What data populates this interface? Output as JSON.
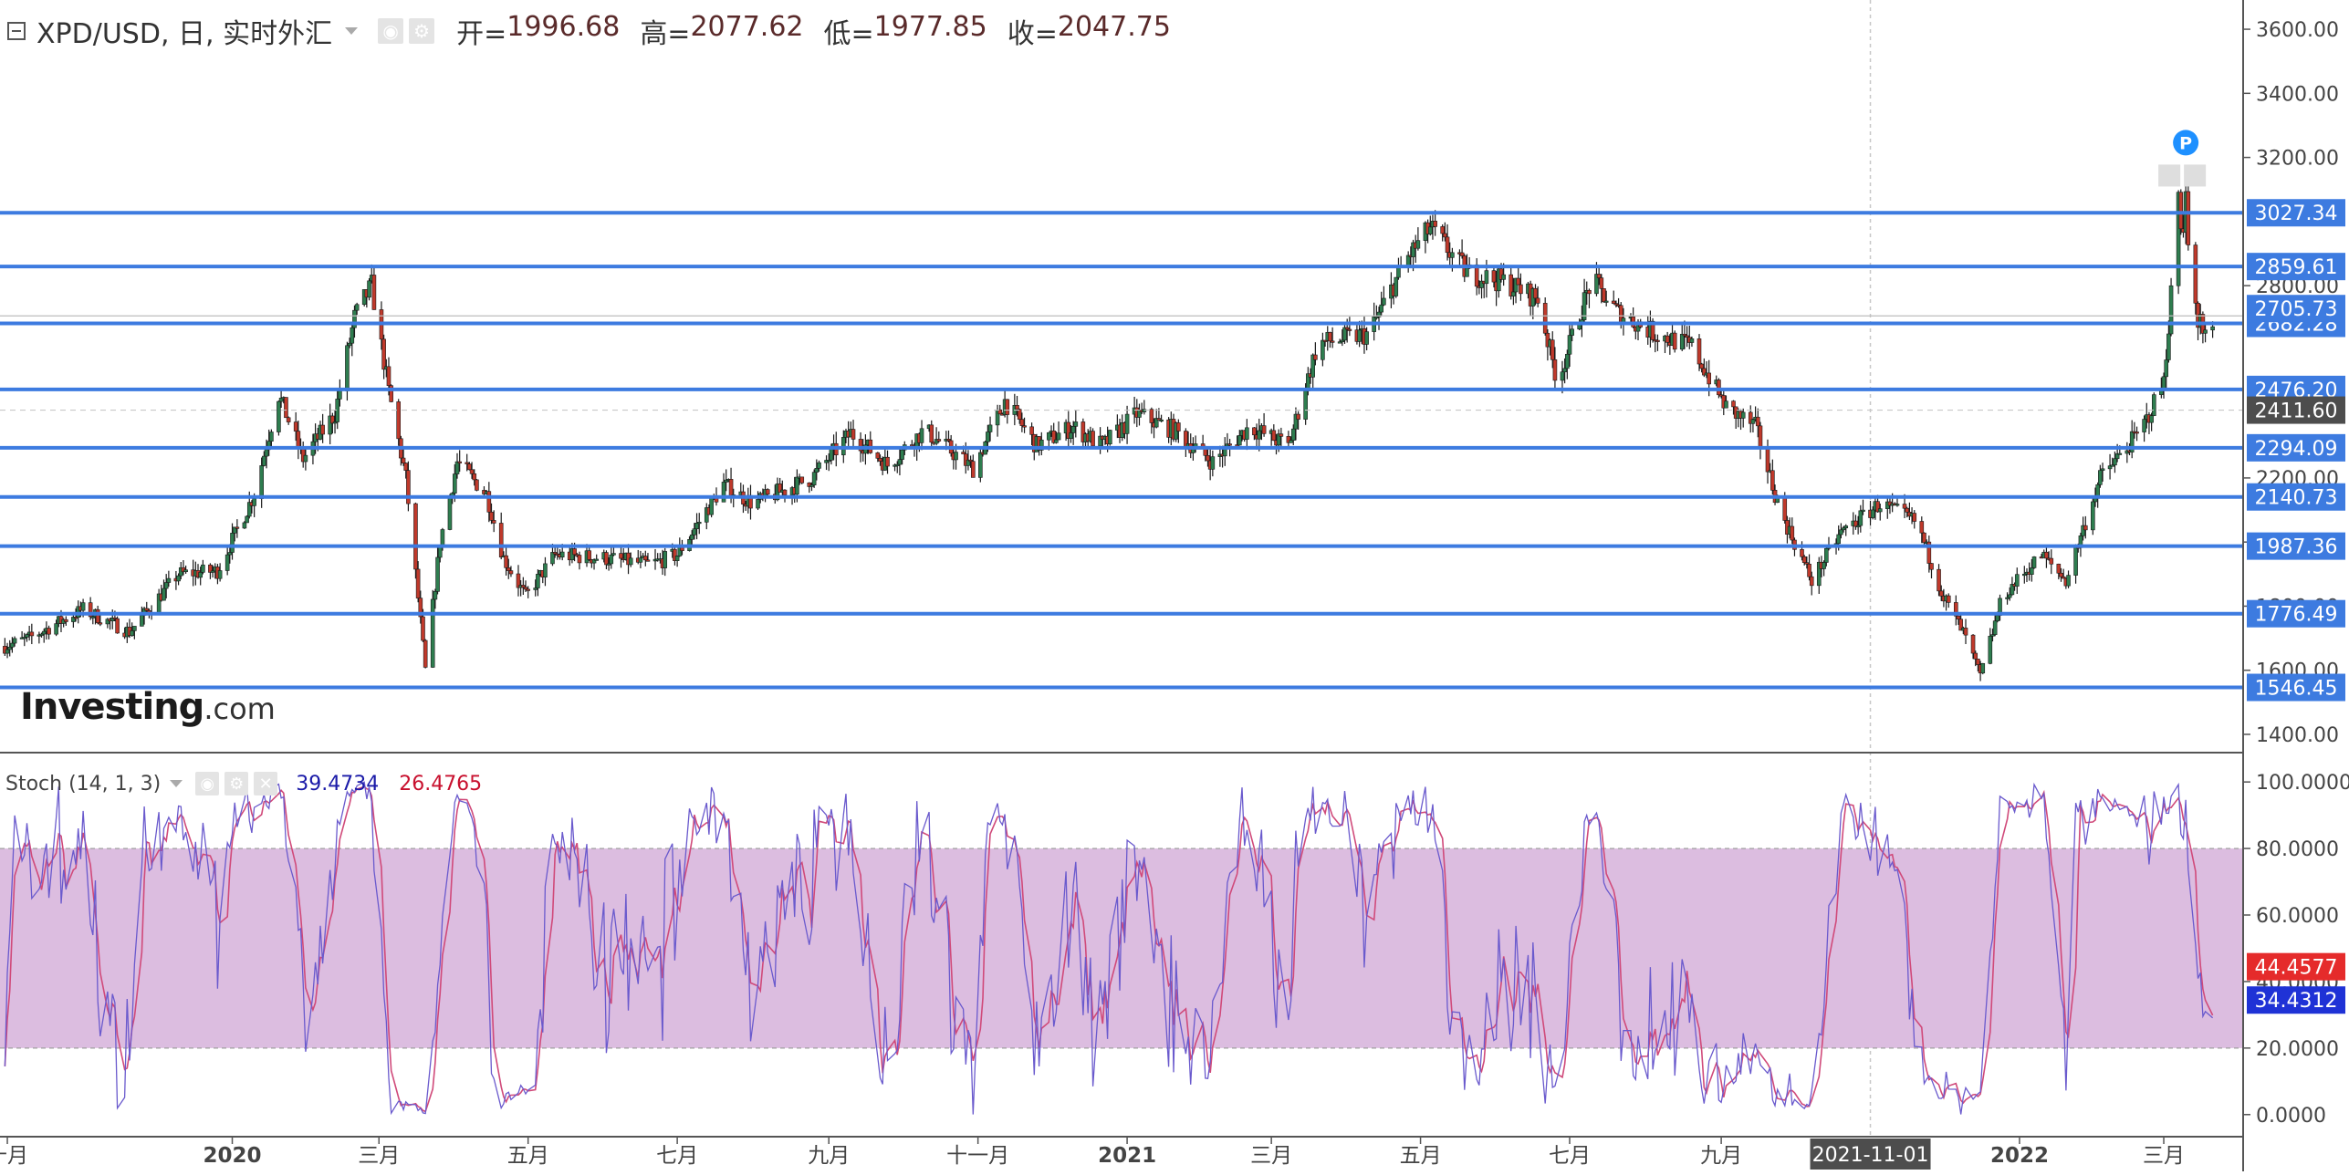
{
  "header": {
    "symbol_title": "XPD/USD, 日, 实时外汇",
    "ohlc": [
      {
        "label": "开=",
        "value": "1996.68"
      },
      {
        "label": "高=",
        "value": "2077.62"
      },
      {
        "label": "低=",
        "value": "1977.85"
      },
      {
        "label": "收=",
        "value": "2047.75"
      }
    ]
  },
  "logo": {
    "brand": "Investing",
    "suffix": ".com"
  },
  "stoch_panel": {
    "label": "Stoch (14, 1, 3)",
    "k_value": "39.4734",
    "d_value": "26.4765"
  },
  "colors": {
    "up": "#2e7d4f",
    "down": "#c0392b",
    "hline": "#3d7be0",
    "stoch_k": "#6a5acd",
    "stoch_d": "#d04a7a",
    "stoch_band": "#dcbde0",
    "badge_blue": "#3d7be0",
    "badge_red": "#e52b2b",
    "badge_dark": "#4d4d4d",
    "badge_navy": "#1f32d6"
  },
  "chart_data": [
    {
      "type": "candlestick",
      "title": "XPD/USD, 日, 实时外汇",
      "x_ticks": [
        {
          "date": "2019-10-01",
          "label": "十月",
          "bold": false
        },
        {
          "date": "2020-01-01",
          "label": "2020",
          "bold": true
        },
        {
          "date": "2020-03-01",
          "label": "三月",
          "bold": false
        },
        {
          "date": "2020-05-01",
          "label": "五月",
          "bold": false
        },
        {
          "date": "2020-07-01",
          "label": "七月",
          "bold": false
        },
        {
          "date": "2020-09-01",
          "label": "九月",
          "bold": false
        },
        {
          "date": "2020-11-01",
          "label": "十一月",
          "bold": false
        },
        {
          "date": "2021-01-01",
          "label": "2021",
          "bold": true
        },
        {
          "date": "2021-03-01",
          "label": "三月",
          "bold": false
        },
        {
          "date": "2021-05-01",
          "label": "五月",
          "bold": false
        },
        {
          "date": "2021-07-01",
          "label": "七月",
          "bold": false
        },
        {
          "date": "2021-09-01",
          "label": "九月",
          "bold": false
        },
        {
          "date": "2022-01-01",
          "label": "2022",
          "bold": true
        },
        {
          "date": "2022-03-01",
          "label": "三月",
          "bold": false
        }
      ],
      "x_range": [
        "2019-09-28",
        "2022-03-26"
      ],
      "crosshair_date": "2021-11-01",
      "crosshair_label": "2021-11-01",
      "y_ticks": [
        1400,
        1600,
        1800,
        2000,
        2200,
        2800,
        3200,
        3400,
        3600
      ],
      "y_tick_labels": [
        "1400.00",
        "1600.00",
        "1800.00",
        "2000.00",
        "2200.00",
        "2800.00",
        "3200.00",
        "3400.00",
        "3600.00"
      ],
      "ylim": [
        1380,
        3640
      ],
      "horizontal_levels": [
        3027.34,
        2859.61,
        2682.28,
        2476.2,
        2294.09,
        2140.73,
        1987.36,
        1776.49,
        1546.45
      ],
      "horizontal_level_labels": [
        "3027.34",
        "2859.61",
        "2682.28",
        "2476.20",
        "2294.09",
        "2140.73",
        "1987.36",
        "1776.49",
        "1546.45"
      ],
      "price_badges": [
        {
          "value": 2705.73,
          "label": "2705.73",
          "kind": "current"
        },
        {
          "value": 2411.6,
          "label": "2411.60",
          "kind": "marker"
        }
      ],
      "marker_label": "P",
      "anchors": [
        [
          "2019-09-28",
          1670
        ],
        [
          "2019-10-10",
          1700
        ],
        [
          "2019-11-01",
          1790
        ],
        [
          "2019-11-20",
          1720
        ],
        [
          "2019-12-10",
          1900
        ],
        [
          "2019-12-26",
          1910
        ],
        [
          "2020-01-10",
          2150
        ],
        [
          "2020-01-20",
          2460
        ],
        [
          "2020-01-30",
          2260
        ],
        [
          "2020-02-12",
          2400
        ],
        [
          "2020-02-20",
          2700
        ],
        [
          "2020-02-27",
          2800
        ],
        [
          "2020-03-05",
          2470
        ],
        [
          "2020-03-12",
          2200
        ],
        [
          "2020-03-20",
          1600
        ],
        [
          "2020-03-26",
          2000
        ],
        [
          "2020-04-02",
          2250
        ],
        [
          "2020-04-14",
          2150
        ],
        [
          "2020-04-21",
          1950
        ],
        [
          "2020-04-30",
          1830
        ],
        [
          "2020-05-12",
          1960
        ],
        [
          "2020-06-01",
          1950
        ],
        [
          "2020-06-20",
          1930
        ],
        [
          "2020-07-01",
          1960
        ],
        [
          "2020-07-20",
          2180
        ],
        [
          "2020-08-01",
          2120
        ],
        [
          "2020-08-25",
          2200
        ],
        [
          "2020-09-10",
          2340
        ],
        [
          "2020-09-25",
          2240
        ],
        [
          "2020-10-10",
          2350
        ],
        [
          "2020-10-30",
          2230
        ],
        [
          "2020-11-12",
          2440
        ],
        [
          "2020-11-25",
          2300
        ],
        [
          "2020-12-10",
          2360
        ],
        [
          "2020-12-22",
          2300
        ],
        [
          "2021-01-05",
          2400
        ],
        [
          "2021-01-20",
          2350
        ],
        [
          "2021-02-05",
          2250
        ],
        [
          "2021-02-20",
          2360
        ],
        [
          "2021-03-08",
          2300
        ],
        [
          "2021-03-20",
          2620
        ],
        [
          "2021-04-10",
          2650
        ],
        [
          "2021-04-25",
          2880
        ],
        [
          "2021-05-05",
          2980
        ],
        [
          "2021-05-20",
          2840
        ],
        [
          "2021-06-05",
          2810
        ],
        [
          "2021-06-18",
          2760
        ],
        [
          "2021-06-26",
          2500
        ],
        [
          "2021-07-10",
          2820
        ],
        [
          "2021-07-20",
          2720
        ],
        [
          "2021-08-05",
          2650
        ],
        [
          "2021-08-20",
          2610
        ],
        [
          "2021-09-03",
          2420
        ],
        [
          "2021-09-15",
          2360
        ],
        [
          "2021-09-25",
          2100
        ],
        [
          "2021-10-08",
          1880
        ],
        [
          "2021-10-20",
          2030
        ],
        [
          "2021-11-05",
          2120
        ],
        [
          "2021-11-20",
          2060
        ],
        [
          "2021-12-01",
          1830
        ],
        [
          "2021-12-10",
          1700
        ],
        [
          "2021-12-16",
          1580
        ],
        [
          "2021-12-25",
          1830
        ],
        [
          "2022-01-10",
          1960
        ],
        [
          "2022-01-20",
          1880
        ],
        [
          "2022-02-03",
          2200
        ],
        [
          "2022-02-20",
          2350
        ],
        [
          "2022-03-01",
          2500
        ],
        [
          "2022-03-07",
          3050
        ],
        [
          "2022-03-09",
          3000
        ],
        [
          "2022-03-15",
          2700
        ],
        [
          "2022-03-21",
          2650
        ]
      ]
    },
    {
      "type": "line",
      "title": "Stoch (14, 1, 3)",
      "ylim": [
        -5,
        108
      ],
      "y_ticks": [
        0,
        20,
        40,
        60,
        80,
        100
      ],
      "y_tick_labels": [
        "0.0000",
        "20.0000",
        "40.0000",
        "60.0000",
        "80.0000",
        "100.0000"
      ],
      "band": [
        20,
        80
      ],
      "badges": [
        {
          "value": 44.4577,
          "label": "44.4577",
          "kind": "d"
        },
        {
          "value": 34.4312,
          "label": "34.4312",
          "kind": "k"
        }
      ]
    }
  ]
}
